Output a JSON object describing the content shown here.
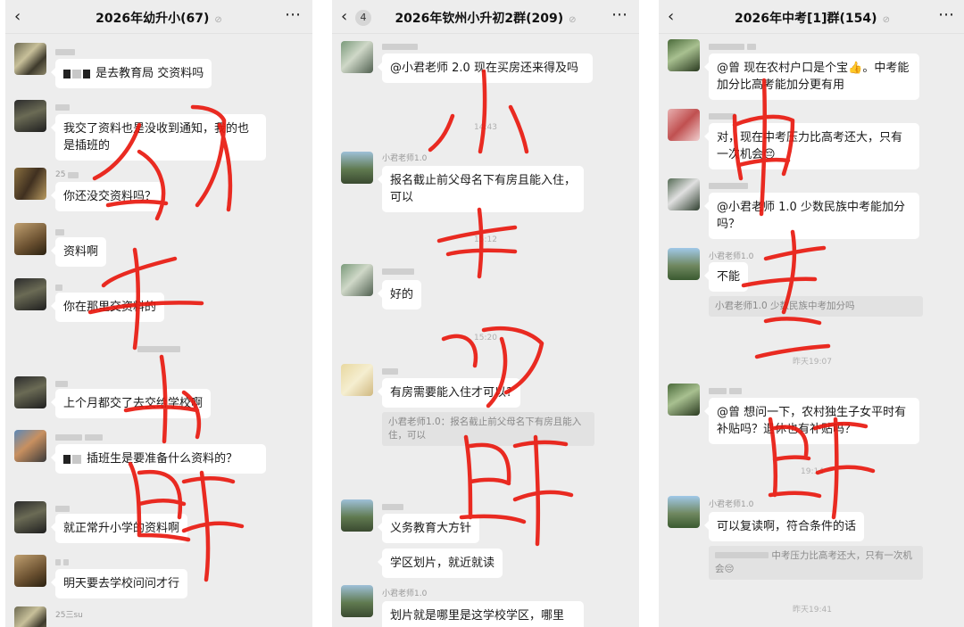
{
  "panels": [
    {
      "back_icon": "chevron-left-icon",
      "title": "2026年幼升小(67)",
      "messages": [
        {
          "sender": "",
          "text": "是去教育局 交资料吗"
        },
        {
          "sender": "",
          "text": "我交了资料也是没收到通知，我的也是插班的"
        },
        {
          "sender": "25",
          "text": "你还没交资料吗？"
        },
        {
          "sender": "",
          "text": "资料啊"
        },
        {
          "sender": "",
          "text": "你在那里交资料的"
        },
        {
          "sender": "",
          "text": "上个月都交了去交给学校啊"
        },
        {
          "sender": "",
          "text": "插班生是要准备什么资料的？"
        },
        {
          "sender": "",
          "text": "就正常升小学的资料啊"
        },
        {
          "sender": "",
          "text": "明天要去学校问问才行"
        },
        {
          "sender": "25三su",
          "text": ""
        }
      ]
    },
    {
      "back_icon": "chevron-left-icon",
      "unread_badge": "4",
      "title": "2026年钦州小升初2群(209)",
      "messages": [
        {
          "sender": "",
          "text": "@小君老师 2.0 现在买房还来得及吗"
        },
        {
          "time": "14:43"
        },
        {
          "sender": "小君老师1.0",
          "text": "报名截止前父母名下有房且能入住，可以"
        },
        {
          "time": "15:12"
        },
        {
          "sender": "",
          "text": "好的"
        },
        {
          "time": "15:20"
        },
        {
          "sender": "",
          "text": "有房需要能入住才可以?",
          "quote": "小君老师1.0：报名截止前父母名下有房且能入住，可以"
        },
        {
          "sender": "",
          "text": "义务教育大方针"
        },
        {
          "text": "学区划片，就近就读"
        },
        {
          "sender": "小君老师1.0",
          "text": "划片就是哪里是这学校学区，哪里"
        }
      ]
    },
    {
      "back_icon": "chevron-left-icon",
      "title": "2026年中考[1]群(154)",
      "messages": [
        {
          "sender": "",
          "text": "@曾  现在农村户口是个宝👍。中考能加分比高考能加分更有用"
        },
        {
          "sender": "",
          "text": "对，现在中考压力比高考还大，只有一次机会😔"
        },
        {
          "sender": "",
          "text": "@小君老师 1.0 少数民族中考能加分吗？"
        },
        {
          "sender": "小君老师1.0",
          "text": "不能",
          "quote": "小君老师1.0 少数民族中考加分吗"
        },
        {
          "time": "昨天19:07"
        },
        {
          "sender": "",
          "text": "@曾  想问一下，农村独生子女平时有补贴吗？退休也有补贴吗？"
        },
        {
          "time": "19:14"
        },
        {
          "sender": "小君老师1.0",
          "text": "可以复读啊，符合条件的话",
          "quote": "中考压力比高考还大，只有一次机会😔"
        },
        {
          "time": "昨天19:41"
        }
      ]
    }
  ],
  "handwriting": [
    "幼升小群",
    "小升初群",
    "中考群"
  ],
  "colors": {
    "ink": "#e8190f",
    "chat_bg": "#ededed",
    "bubble": "#ffffff"
  }
}
